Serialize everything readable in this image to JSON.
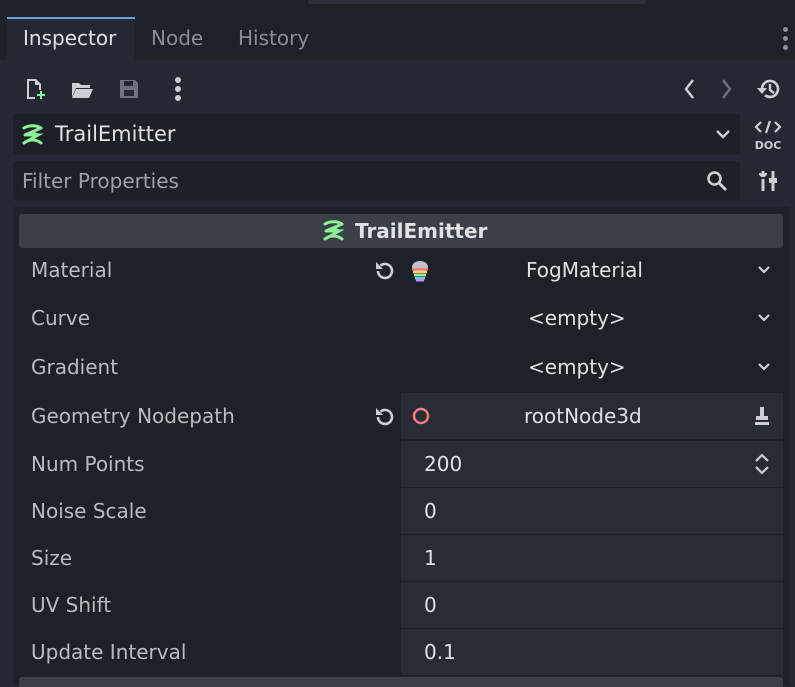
{
  "tabs": [
    {
      "label": "Inspector",
      "active": true
    },
    {
      "label": "Node",
      "active": false
    },
    {
      "label": "History",
      "active": false
    }
  ],
  "toolbar": {
    "icons": [
      "new-resource-icon",
      "open-folder-icon",
      "save-icon",
      "more-icon",
      "back-icon",
      "forward-icon",
      "history-icon"
    ]
  },
  "object": {
    "name": "TrailEmitter",
    "doc_label": "DOC"
  },
  "filter": {
    "placeholder": "Filter Properties",
    "value": ""
  },
  "section": {
    "title": "TrailEmitter"
  },
  "properties": [
    {
      "label": "Material",
      "value": "FogMaterial"
    },
    {
      "label": "Curve",
      "value": "<empty>"
    },
    {
      "label": "Gradient",
      "value": "<empty>"
    },
    {
      "label": "Geometry Nodepath",
      "value": "rootNode3d"
    },
    {
      "label": "Num Points",
      "value": "200"
    },
    {
      "label": "Noise Scale",
      "value": "0"
    },
    {
      "label": "Size",
      "value": "1"
    },
    {
      "label": "UV Shift",
      "value": "0"
    },
    {
      "label": "Update Interval",
      "value": "0.1"
    }
  ],
  "colors": {
    "accent": "#6aa1dc",
    "node_green": "#8eef97",
    "node3d_red": "#fc7f7f"
  }
}
